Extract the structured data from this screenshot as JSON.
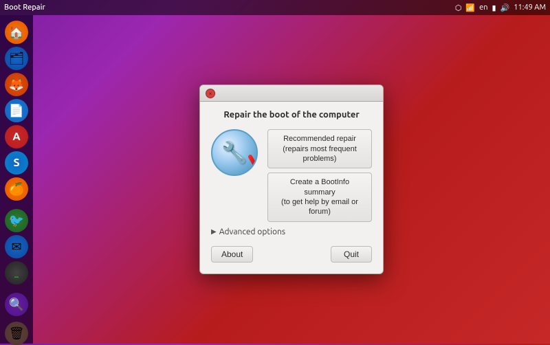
{
  "taskbar": {
    "title": "Boot Repair",
    "time": "11:49 AM",
    "icons": [
      "dropbox",
      "signal",
      "en",
      "battery",
      "volume"
    ]
  },
  "sidebar": {
    "items": [
      {
        "name": "home",
        "icon": "🏠",
        "style": "icon-home"
      },
      {
        "name": "files",
        "icon": "🗂",
        "style": "icon-files"
      },
      {
        "name": "firefox",
        "icon": "🦊",
        "style": "icon-firefox"
      },
      {
        "name": "libreoffice",
        "icon": "📄",
        "style": "icon-libre"
      },
      {
        "name": "software-center",
        "icon": "A",
        "style": "icon-software"
      },
      {
        "name": "skype",
        "icon": "S",
        "style": "icon-skype"
      },
      {
        "name": "theme",
        "icon": "🍊",
        "style": "icon-theme"
      },
      {
        "name": "bird",
        "icon": "🐦",
        "style": "icon-bird"
      },
      {
        "name": "mail",
        "icon": "✉",
        "style": "icon-mail"
      },
      {
        "name": "terminal",
        "icon": "⬛",
        "style": "icon-terminal"
      },
      {
        "name": "search",
        "icon": "🔍",
        "style": "icon-search"
      },
      {
        "name": "trash",
        "icon": "🗑",
        "style": "icon-trash"
      }
    ]
  },
  "dialog": {
    "title": "Repair the boot of the computer",
    "close_label": "×",
    "recommended_repair_line1": "Recommended repair",
    "recommended_repair_line2": "(repairs most frequent problems)",
    "bootinfo_line1": "Create a BootInfo summary",
    "bootinfo_line2": "(to get help by email or forum)",
    "advanced_options_label": "Advanced options",
    "about_label": "About",
    "quit_label": "Quit"
  }
}
